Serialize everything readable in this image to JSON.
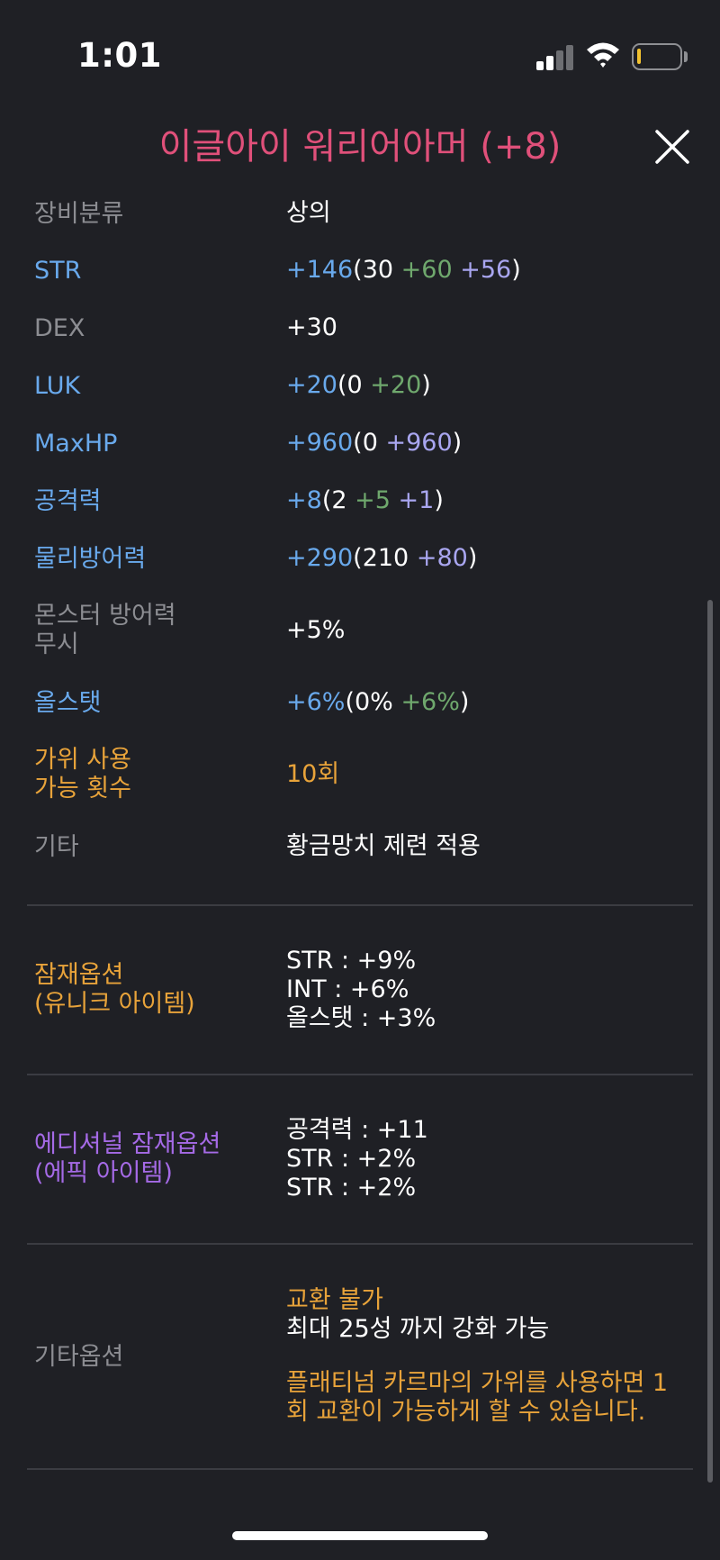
{
  "status_bar": {
    "time": "1:01"
  },
  "header": {
    "title": "이글아이 워리어아머 (+8)"
  },
  "stats": {
    "category": {
      "label": "장비분류",
      "value": "상의"
    },
    "str": {
      "label": "STR",
      "total": "+146",
      "open": "(30",
      "add1": "+60",
      "add2": "+56",
      "close": ")"
    },
    "dex": {
      "label": "DEX",
      "value": "+30"
    },
    "luk": {
      "label": "LUK",
      "total": "+20",
      "open": "(0",
      "add1": "+20",
      "close": ")"
    },
    "maxhp": {
      "label": "MaxHP",
      "total": "+960",
      "open": "(0",
      "add1": "+960",
      "close": ")"
    },
    "attack": {
      "label": "공격력",
      "total": "+8",
      "open": "(2",
      "add1": "+5",
      "add2": "+1",
      "close": ")"
    },
    "defense": {
      "label": "물리방어력",
      "total": "+290",
      "open": "(210",
      "add1": "+80",
      "close": ")"
    },
    "ignore_def": {
      "label_line1": "몬스터 방어력",
      "label_line2": "무시",
      "value": "+5%"
    },
    "all_stat": {
      "label": "올스탯",
      "total": "+6%",
      "open": "(0%",
      "add1": "+6%",
      "close": ")"
    },
    "scissors": {
      "label_line1": "가위 사용",
      "label_line2": "가능 횟수",
      "value": "10회"
    },
    "etc": {
      "label": "기타",
      "value": "황금망치 제련 적용"
    }
  },
  "potential": {
    "label_line1": "잠재옵션",
    "label_line2": "(유니크 아이템)",
    "lines": [
      "STR : +9%",
      "INT : +6%",
      "올스탯 : +3%"
    ]
  },
  "additional": {
    "label_line1": "에디셔널 잠재옵션",
    "label_line2": "(에픽 아이템)",
    "lines": [
      "공격력 : +11",
      "STR : +2%",
      "STR : +2%"
    ]
  },
  "other": {
    "label": "기타옵션",
    "trade": "교환 불가",
    "star": "최대 25성 까지 강화 가능",
    "karma_line1": "플래티넘 카르마의 가위를 사용하면 1",
    "karma_line2": "회 교환이 가능하게 할 수 있습니다."
  },
  "colors": {
    "background": "#1f2025",
    "title": "#e0507a",
    "blue": "#69a9ec",
    "green": "#6fa86d",
    "lavender": "#a9a6f0",
    "orange": "#e8a33a",
    "purple": "#a56ae6",
    "gray": "#8c8d92"
  }
}
